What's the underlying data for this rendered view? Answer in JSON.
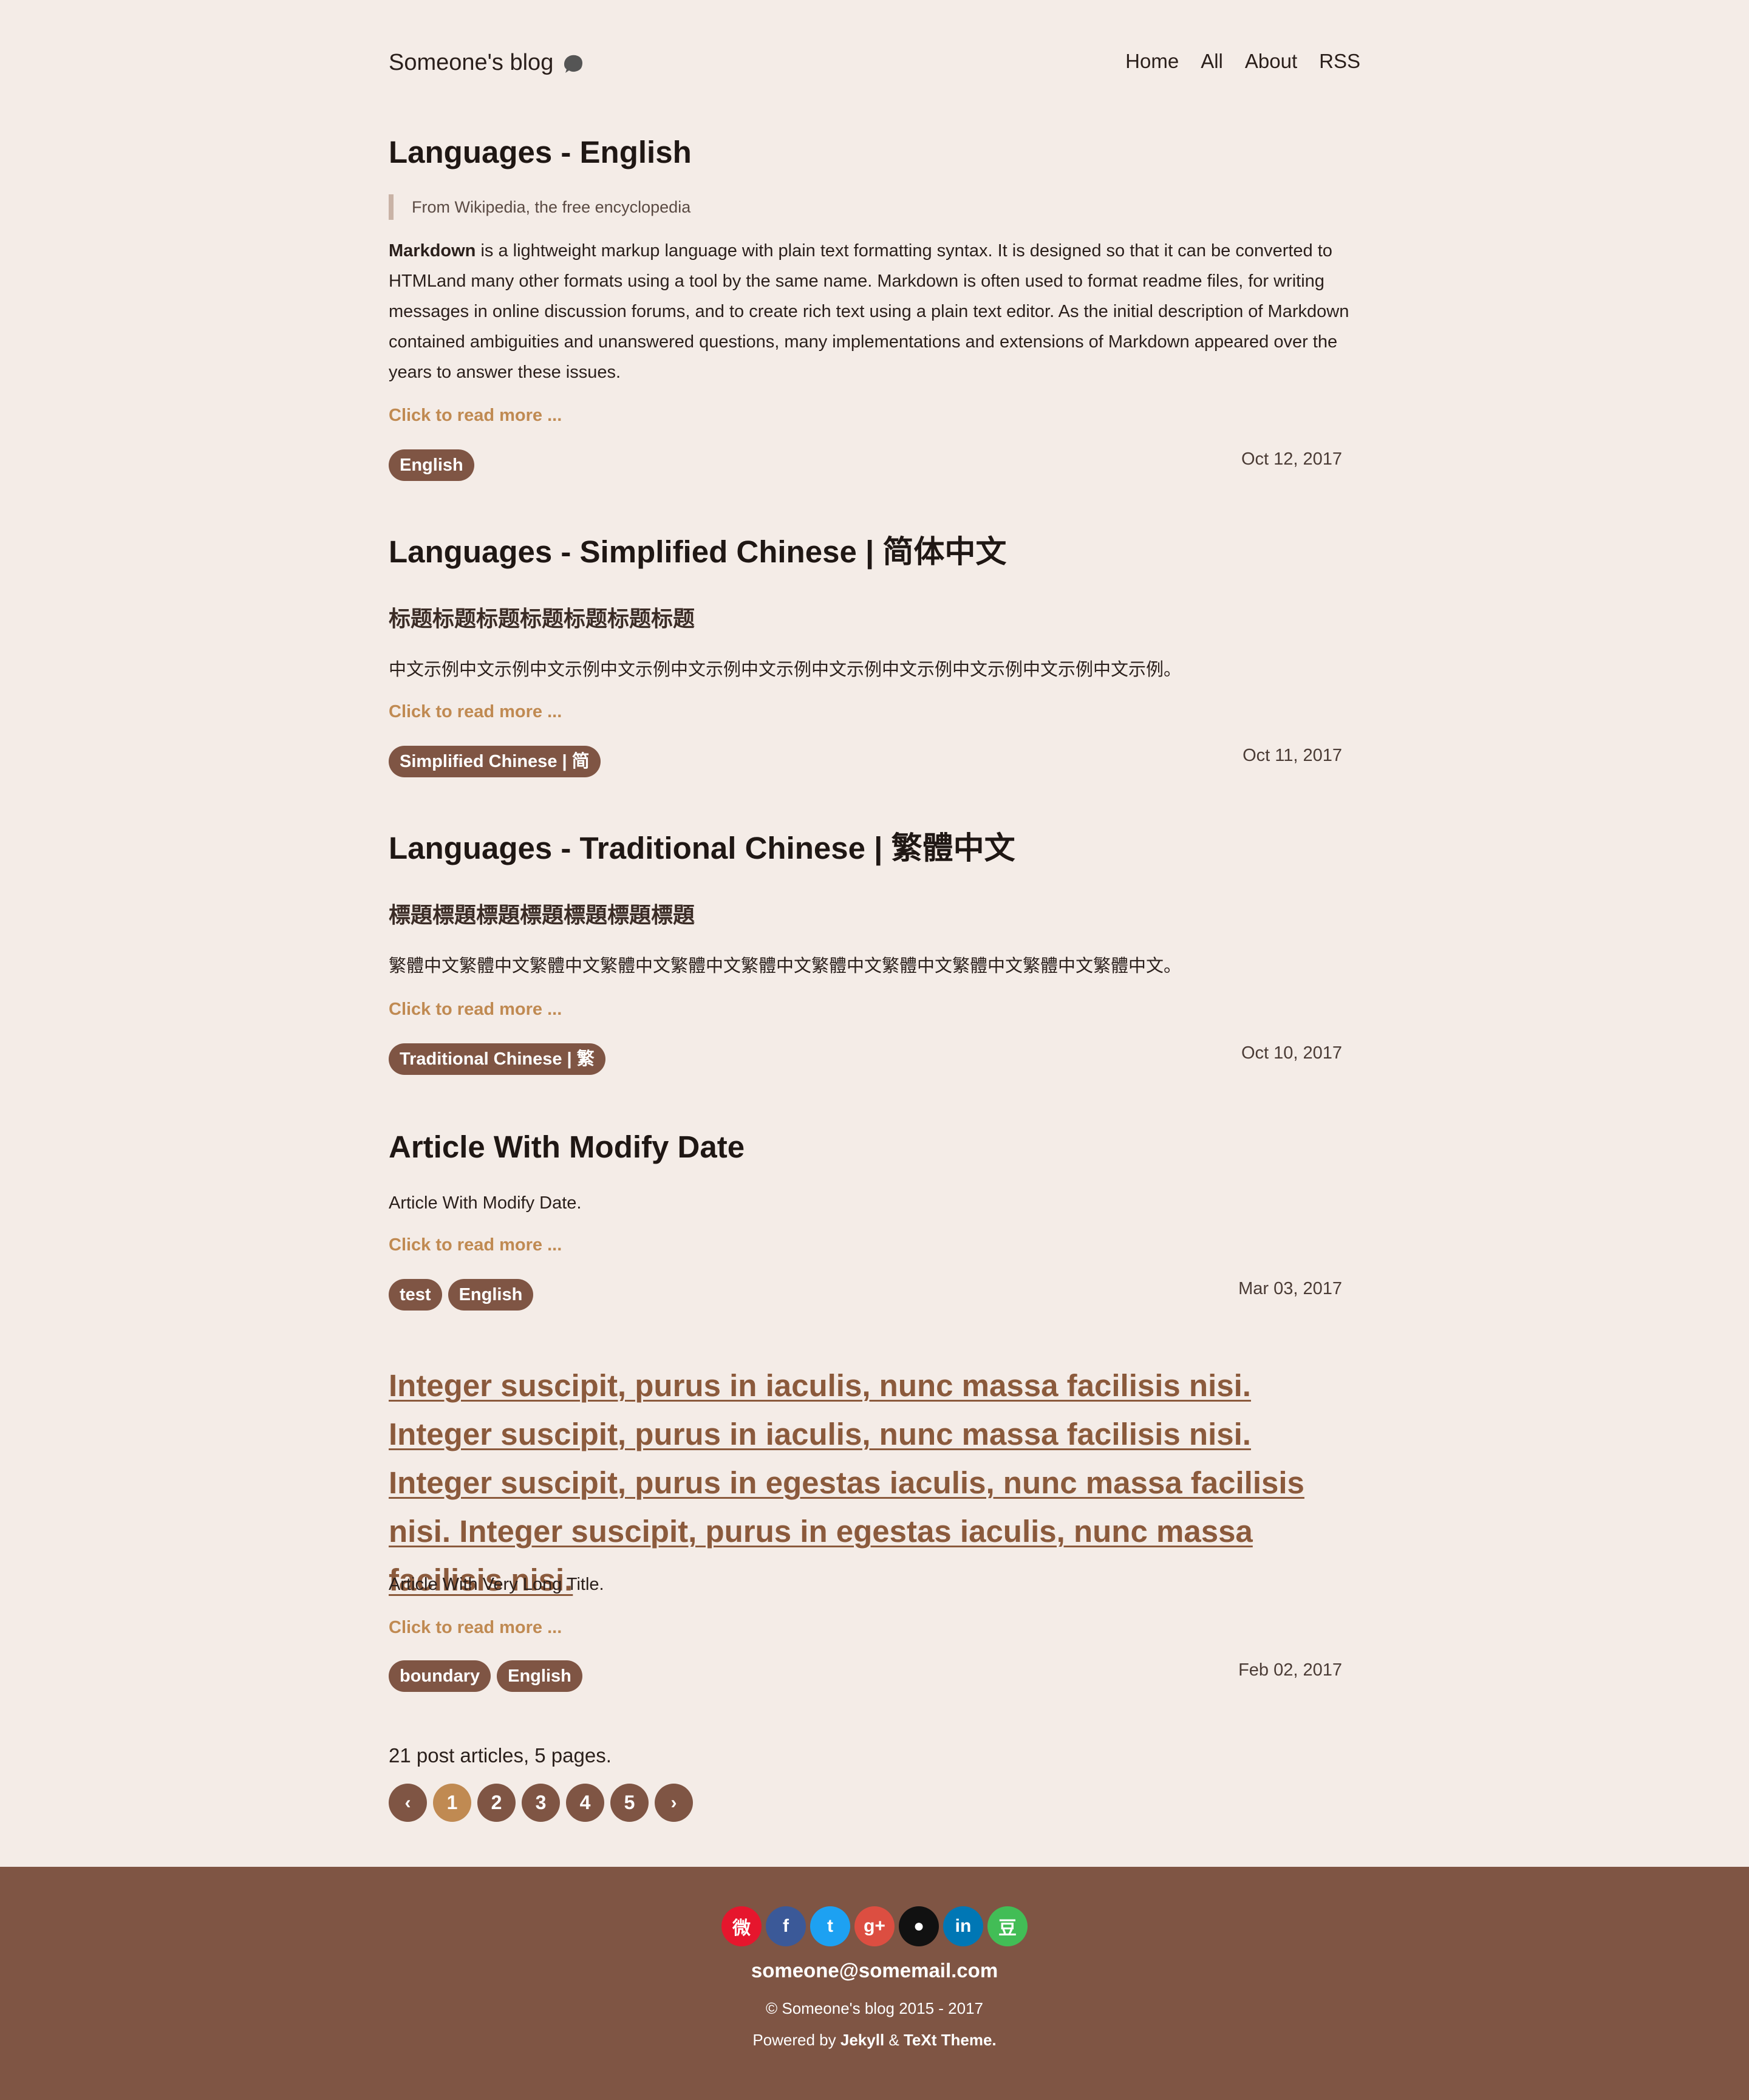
{
  "header": {
    "site_title": "Someone's blog",
    "nav": [
      "Home",
      "All",
      "About",
      "RSS"
    ]
  },
  "posts": [
    {
      "title": "Languages - English",
      "quote": "From Wikipedia, the free encyclopedia",
      "lead_bold": "Markdown",
      "text": " is a lightweight markup language with plain text formatting syntax. It is designed so that it can be converted to HTMLand many other formats using a tool by the same name. Markdown is often used to format readme files, for writing messages in online discussion forums, and to create rich text using a plain text editor. As the initial description of Markdown contained ambiguities and unanswered questions, many implementations and extensions of Markdown appeared over the years to answer these issues.",
      "read_more": "Click to read more ...",
      "tags": [
        "English"
      ],
      "date": "Oct 12, 2017"
    },
    {
      "title": "Languages - Simplified Chinese | 简体中文",
      "subhead": "标题标题标题标题标题标题标题",
      "text": "中文示例中文示例中文示例中文示例中文示例中文示例中文示例中文示例中文示例中文示例中文示例。",
      "read_more": "Click to read more ...",
      "tags": [
        "Simplified Chinese | 简"
      ],
      "date": "Oct 11, 2017"
    },
    {
      "title": "Languages - Traditional Chinese | 繁體中文",
      "subhead": "標題標題標題標題標題標題標題",
      "text": "繁體中文繁體中文繁體中文繁體中文繁體中文繁體中文繁體中文繁體中文繁體中文繁體中文繁體中文。",
      "read_more": "Click to read more ...",
      "tags": [
        "Traditional Chinese | 繁"
      ],
      "date": "Oct 10, 2017"
    },
    {
      "title": "Article With Modify Date",
      "text": "Article With Modify Date.",
      "read_more": "Click to read more ...",
      "tags": [
        "test",
        "English"
      ],
      "date": "Mar 03, 2017"
    },
    {
      "title": "Integer suscipit, purus in iaculis, nunc massa facilisis nisi. Integer suscipit, purus in iaculis, nunc massa facilisis nisi. Integer suscipit, purus in egestas iaculis, nunc massa facilisis nisi. Integer suscipit, purus in egestas iaculis, nunc massa facilisis nisi.",
      "text": "Article With Very Long Title.",
      "read_more": "Click to read more ...",
      "tags": [
        "boundary",
        "English"
      ],
      "date": "Feb 02, 2017"
    }
  ],
  "pagination": {
    "summary": "21 post articles, 5 pages.",
    "prev": "‹",
    "pages": [
      "1",
      "2",
      "3",
      "4",
      "5"
    ],
    "next": "›",
    "current": "1"
  },
  "footer": {
    "socials": [
      {
        "name": "weibo-icon",
        "glyph": "微",
        "color": "#e6162d"
      },
      {
        "name": "facebook-icon",
        "glyph": "f",
        "color": "#3b5998"
      },
      {
        "name": "twitter-icon",
        "glyph": "t",
        "color": "#1da1f2"
      },
      {
        "name": "google-plus-icon",
        "glyph": "g+",
        "color": "#dc4e41"
      },
      {
        "name": "github-icon",
        "glyph": "●",
        "color": "#111111"
      },
      {
        "name": "linkedin-icon",
        "glyph": "in",
        "color": "#0077b5"
      },
      {
        "name": "douban-icon",
        "glyph": "豆",
        "color": "#42bd56"
      }
    ],
    "email": "someone@somemail.com",
    "copyright": "© Someone's blog 2015 - 2017",
    "powered_prefix": "Powered by ",
    "powered_jekyll": "Jekyll",
    "powered_amp": " & ",
    "powered_theme": "TeXt Theme."
  }
}
